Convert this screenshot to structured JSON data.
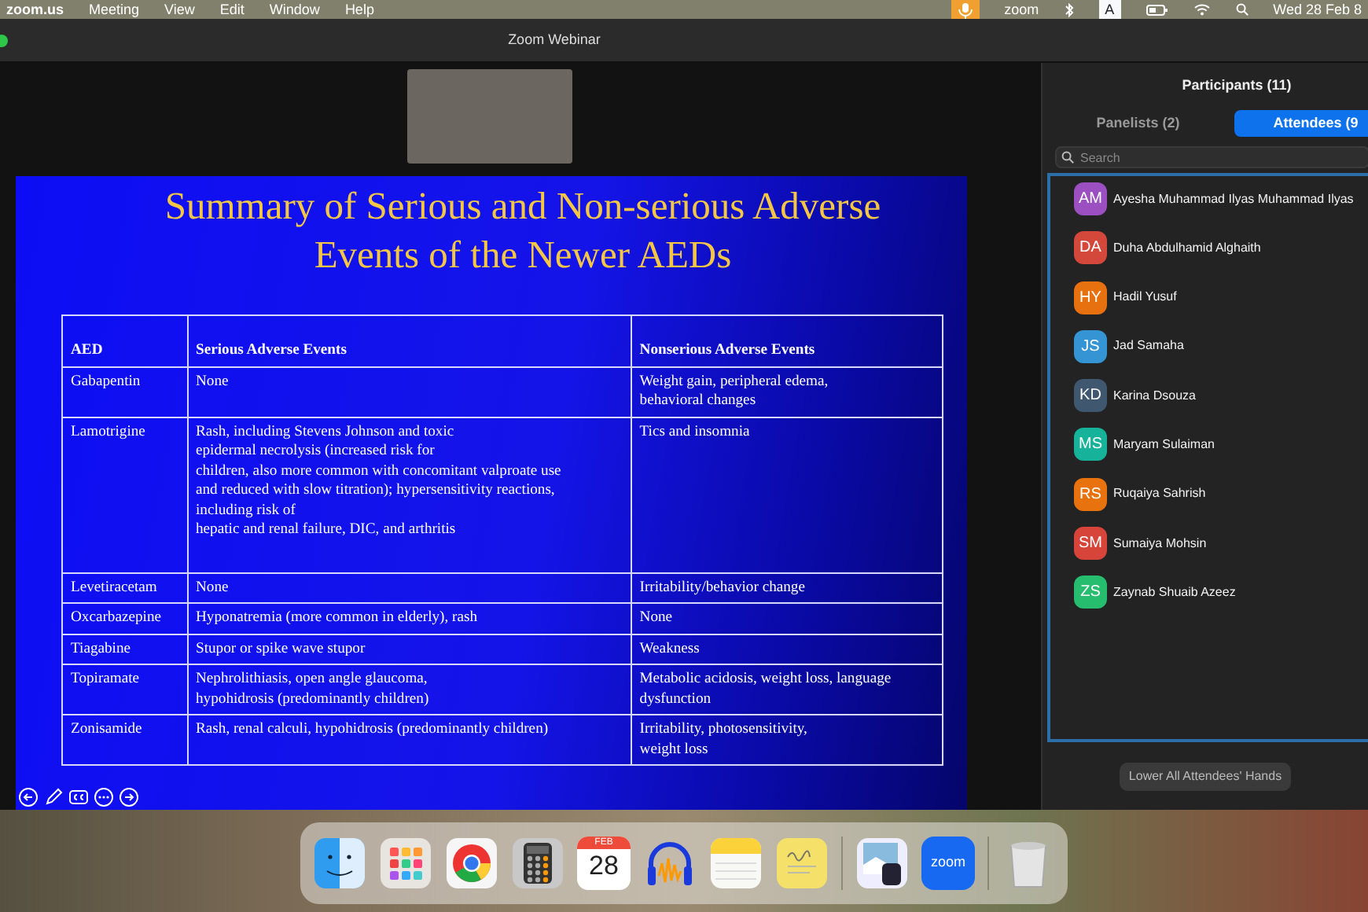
{
  "menu_bar": {
    "app": "zoom.us",
    "menus": [
      "Meeting",
      "View",
      "Edit",
      "Window",
      "Help"
    ],
    "status_label": "zoom",
    "input_letter": "A",
    "clock": "Wed 28 Feb 8"
  },
  "window": {
    "title": "Zoom Webinar"
  },
  "slide": {
    "title": "Summary of Serious and Non-serious Adverse Events of the Newer AEDs",
    "columns": [
      "AED",
      "Serious Adverse Events",
      "Nonserious Adverse Events"
    ],
    "rows": [
      {
        "aed": "Gabapentin",
        "serious": "None",
        "nonserious": "Weight gain, peripheral edema,\nbehavioral changes"
      },
      {
        "aed": "Lamotrigine",
        "serious": "Rash, including Stevens Johnson and toxic\nepidermal necrolysis (increased risk for\nchildren, also more common with concomitant valproate use\nand reduced with slow titration); hypersensitivity reactions,\nincluding risk of\nhepatic and renal failure, DIC, and arthritis",
        "nonserious": "Tics and insomnia"
      },
      {
        "aed": "Levetiracetam",
        "serious": "None",
        "nonserious": "Irritability/behavior change"
      },
      {
        "aed": "Oxcarbazepine",
        "serious": "Hyponatremia (more common in elderly), rash",
        "nonserious": "None"
      },
      {
        "aed": "Tiagabine",
        "serious": "Stupor or spike wave stupor",
        "nonserious": "Weakness"
      },
      {
        "aed": "Topiramate",
        "serious": "Nephrolithiasis, open angle glaucoma,\nhypohidrosis (predominantly children)",
        "nonserious": "Metabolic acidosis, weight loss, language\ndysfunction"
      },
      {
        "aed": "Zonisamide",
        "serious": "Rash, renal calculi, hypohidrosis (predominantly children)",
        "nonserious": "Irritability, photosensitivity,\nweight loss"
      }
    ]
  },
  "participants": {
    "title": "Participants (11)",
    "tabs": [
      {
        "label": "Panelists (2)",
        "selected": false
      },
      {
        "label": "Attendees (9",
        "selected": true
      }
    ],
    "search": {
      "placeholder": "Search"
    },
    "attendees": [
      {
        "initials": "AM",
        "name": "Ayesha Muhammad Ilyas Muhammad Ilyas",
        "color": "#9b4fc0"
      },
      {
        "initials": "DA",
        "name": "Duha Abdulhamid Alghaith",
        "color": "#d4483b"
      },
      {
        "initials": "HY",
        "name": "Hadil Yusuf",
        "color": "#e8710f"
      },
      {
        "initials": "JS",
        "name": "Jad Samaha",
        "color": "#3595d4"
      },
      {
        "initials": "KD",
        "name": "Karina Dsouza",
        "color": "#3f5870"
      },
      {
        "initials": "MS",
        "name": "Maryam Sulaiman",
        "color": "#16b39a"
      },
      {
        "initials": "RS",
        "name": "Ruqaiya Sahrish",
        "color": "#e8730e"
      },
      {
        "initials": "SM",
        "name": "Sumaiya Mohsin",
        "color": "#d7443a"
      },
      {
        "initials": "ZS",
        "name": "Zaynab Shuaib Azeez",
        "color": "#27bd6e"
      }
    ],
    "button": "Lower All Attendees' Hands"
  },
  "dock": {
    "calendar_month": "FEB",
    "calendar_day": "28",
    "zoom_label": "zoom"
  }
}
